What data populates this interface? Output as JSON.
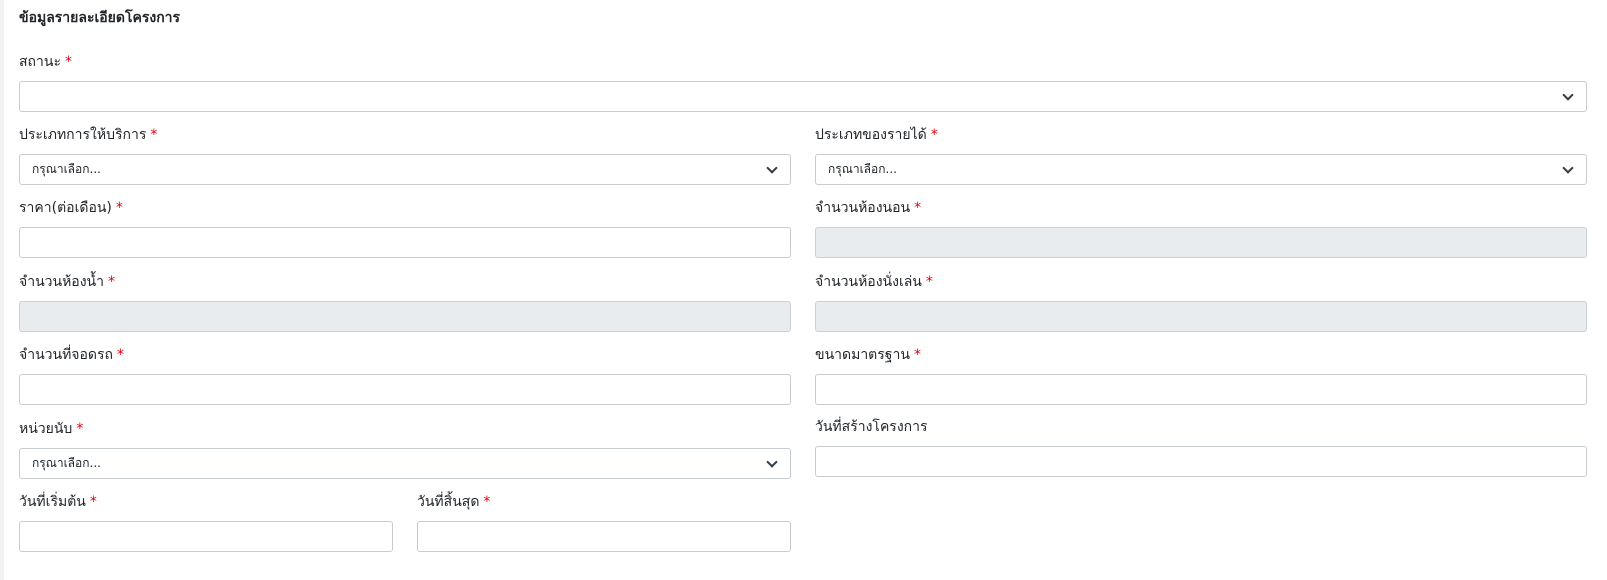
{
  "section_title": "ข้อมูลรายละเอียดโครงการ",
  "required_mark": "*",
  "fields": {
    "status": {
      "label": "สถานะ",
      "value": ""
    },
    "service_type": {
      "label": "ประเภทการให้บริการ",
      "value": "กรุณาเลือก..."
    },
    "income_type": {
      "label": "ประเภทของรายได้",
      "value": "กรุณาเลือก..."
    },
    "price": {
      "label": "ราคา(ต่อเดือน)",
      "value": ""
    },
    "bedrooms": {
      "label": "จำนวนห้องนอน",
      "value": ""
    },
    "bathrooms": {
      "label": "จำนวนห้องน้ำ",
      "value": ""
    },
    "living_rooms": {
      "label": "จำนวนห้องนั่งเล่น",
      "value": ""
    },
    "parking": {
      "label": "จำนวนที่จอดรถ",
      "value": ""
    },
    "standard_size": {
      "label": "ขนาดมาตรฐาน",
      "value": ""
    },
    "unit": {
      "label": "หน่วยนับ",
      "value": "กรุณาเลือก..."
    },
    "created_date": {
      "label": "วันที่สร้างโครงการ",
      "value": ""
    },
    "start_date": {
      "label": "วันที่เริ่มต้น",
      "value": ""
    },
    "end_date": {
      "label": "วันที่สิ้นสุด",
      "value": ""
    }
  },
  "colors": {
    "required": "#e3000f",
    "disabled_bg": "#e9ecef",
    "border": "#c7ccd1"
  }
}
